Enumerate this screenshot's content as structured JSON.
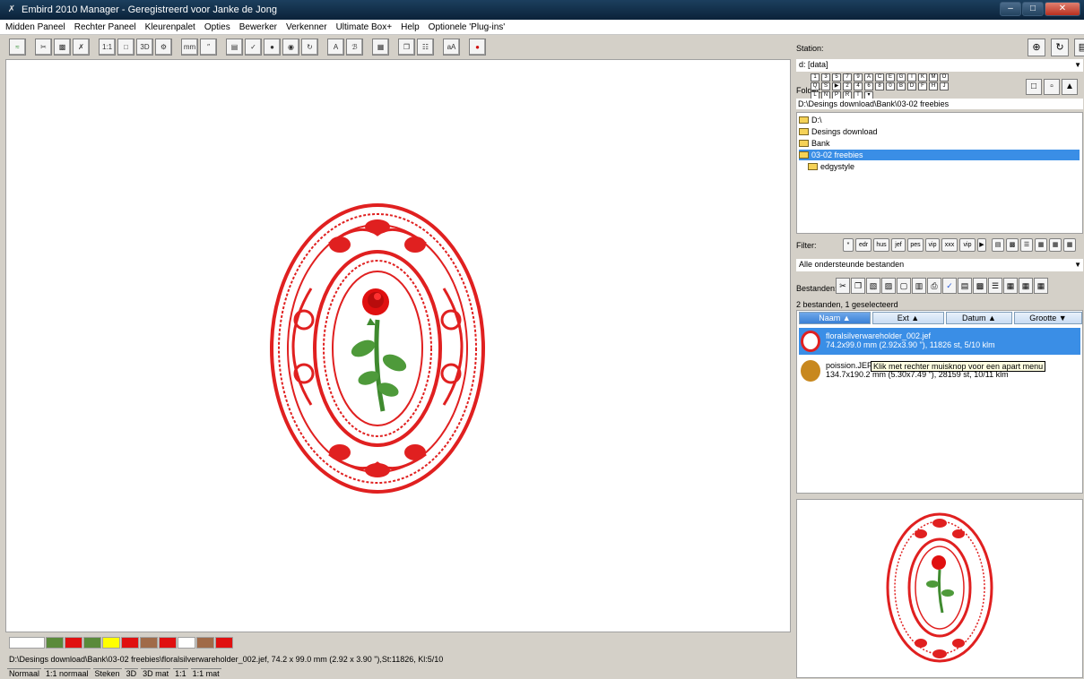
{
  "window": {
    "title": "Embird 2010 Manager - Geregistreerd voor Janke de Jong"
  },
  "menu": [
    "Midden Paneel",
    "Rechter Paneel",
    "Kleurenpalet",
    "Opties",
    "Bewerker",
    "Verkenner",
    "Ultimate Box+",
    "Help",
    "Optionele 'Plug-ins'"
  ],
  "toolbar": {
    "one_to_one": "1:1",
    "three_d": "3D",
    "mm": "mm",
    "a1": "A",
    "a2": "aA"
  },
  "palette": [
    "#ffffff",
    "#5a8a3a",
    "#e01010",
    "#5a8a3a",
    "#ffff00",
    "#e01010",
    "#a06a48",
    "#e01010",
    "#ffffff",
    "#a06a48",
    "#e01010"
  ],
  "status": "D:\\Desings download\\Bank\\03-02 freebies\\floralsilverwareholder_002.jef, 74.2 x 99.0 mm (2.92 x 3.90 \"),St:11826, Kl:5/10",
  "tabs": [
    "Normaal",
    "1:1 normaal",
    "Steken",
    "3D",
    "3D mat",
    "1:1",
    "1:1 mat"
  ],
  "right": {
    "station_label": "Station:",
    "drive": "d: [data]",
    "folder_label": "Folder:",
    "folder_letters": [
      "1",
      "3",
      "5",
      "7",
      "9",
      "A",
      "C",
      "E",
      "G",
      "I",
      "K",
      "M",
      "O",
      "Q",
      "S",
      "▶",
      "2",
      "4",
      "6",
      "8",
      "0",
      "B",
      "D",
      "F",
      "H",
      "J",
      "L",
      "N",
      "P",
      "R",
      "T",
      "▾"
    ],
    "path": "D:\\Desings download\\Bank\\03-02 freebies",
    "tree": [
      "D:\\",
      "Desings download",
      "Bank",
      "03-02 freebies",
      "edgystyle"
    ],
    "filter_label": "Filter:",
    "filter_buttons": [
      "*",
      "edr",
      "hus",
      "jef",
      "pes",
      "vip",
      "xxx",
      "vip"
    ],
    "filter_combo": "Alle ondersteunde bestanden",
    "bestanden_label": "Bestanden:",
    "count": "2 bestanden, 1 geselecteerd",
    "columns": [
      "Naam ▲",
      "Ext ▲",
      "Datum ▲",
      "Grootte ▼"
    ],
    "files": [
      {
        "name": "floralsilverwareholder_002.jef",
        "info": "74.2x99.0 mm (2.92x3.90 \"), 11826 st, 5/10 klm"
      },
      {
        "name": "poission.JEF",
        "info": "134.7x190.2 mm (5.30x7.49 \"), 28159 st, 10/11 klm"
      }
    ],
    "tooltip": "Klik met rechter muisknop voor een apart menu"
  }
}
